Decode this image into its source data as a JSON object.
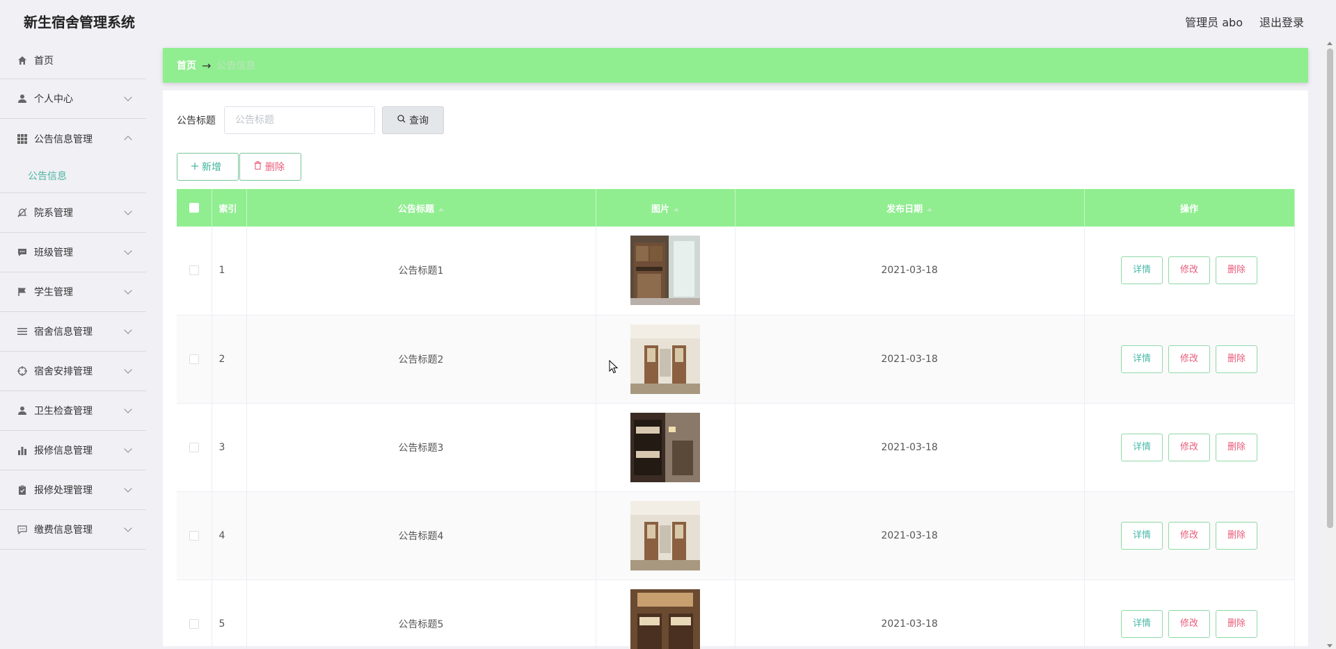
{
  "app": {
    "title": "新生宿舍管理系统"
  },
  "header": {
    "user_label": "管理员 abo",
    "logout_label": "退出登录"
  },
  "sidebar": {
    "items": [
      {
        "label": "首页",
        "icon": "home-icon",
        "expandable": false
      },
      {
        "label": "个人中心",
        "icon": "user-icon",
        "expandable": true
      },
      {
        "label": "公告信息管理",
        "icon": "grid-icon",
        "expandable": true,
        "expanded": true
      },
      {
        "label": "院系管理",
        "icon": "bell-off-icon",
        "expandable": true
      },
      {
        "label": "班级管理",
        "icon": "message-icon",
        "expandable": true
      },
      {
        "label": "学生管理",
        "icon": "flag-icon",
        "expandable": true
      },
      {
        "label": "宿舍信息管理",
        "icon": "list-icon",
        "expandable": true
      },
      {
        "label": "宿舍安排管理",
        "icon": "target-icon",
        "expandable": true
      },
      {
        "label": "卫生检查管理",
        "icon": "user-icon",
        "expandable": true
      },
      {
        "label": "报修信息管理",
        "icon": "bar-chart-icon",
        "expandable": true
      },
      {
        "label": "报修处理管理",
        "icon": "clipboard-icon",
        "expandable": true
      },
      {
        "label": "缴费信息管理",
        "icon": "chat-icon",
        "expandable": true
      }
    ],
    "active_sub": "公告信息"
  },
  "breadcrumb": {
    "home": "首页",
    "separator": "→",
    "current": "公告信息"
  },
  "search": {
    "label": "公告标题",
    "placeholder": "公告标题",
    "button": "查询"
  },
  "actions": {
    "add": "新增",
    "delete": "删除"
  },
  "table": {
    "headers": {
      "index": "索引",
      "title": "公告标题",
      "image": "图片",
      "date": "发布日期",
      "ops": "操作"
    },
    "ops": {
      "detail": "详情",
      "edit": "修改",
      "delete": "删除"
    },
    "rows": [
      {
        "index": "1",
        "title": "公告标题1",
        "date": "2021-03-18",
        "image": "dorm-photo-1"
      },
      {
        "index": "2",
        "title": "公告标题2",
        "date": "2021-03-18",
        "image": "dorm-photo-2"
      },
      {
        "index": "3",
        "title": "公告标题3",
        "date": "2021-03-18",
        "image": "dorm-photo-3"
      },
      {
        "index": "4",
        "title": "公告标题4",
        "date": "2021-03-18",
        "image": "dorm-photo-4"
      },
      {
        "index": "5",
        "title": "公告标题5",
        "date": "2021-03-18",
        "image": "dorm-photo-5"
      }
    ]
  },
  "colors": {
    "accent": "#90ee90",
    "teal": "#3eb49a",
    "danger": "#e85c7a"
  }
}
